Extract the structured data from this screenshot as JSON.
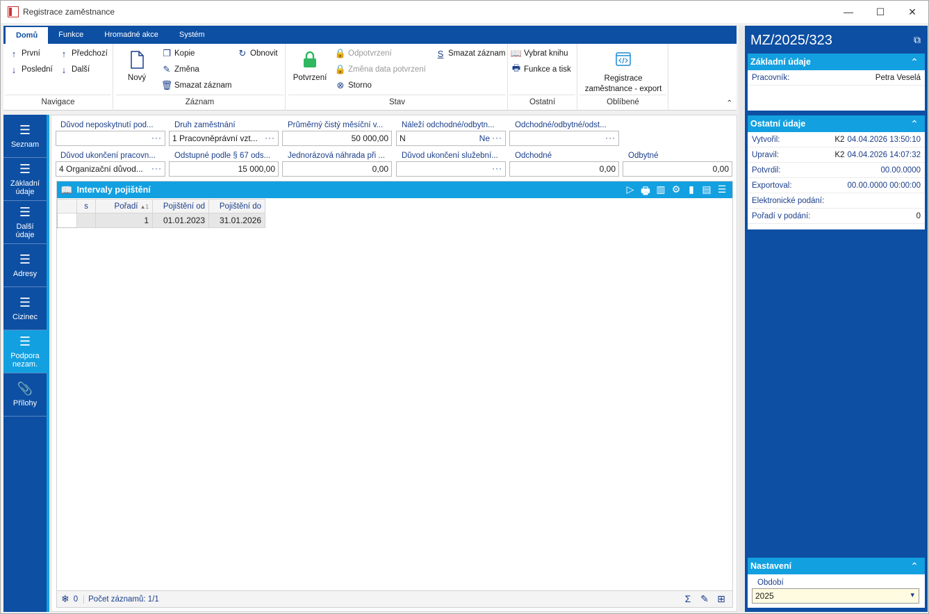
{
  "window": {
    "title": "Registrace zaměstnance"
  },
  "ribbon": {
    "tabs": [
      "Domů",
      "Funkce",
      "Hromadné akce",
      "Systém"
    ],
    "navigace": {
      "prvni": "První",
      "predchozi": "Předchozí",
      "posledni": "Poslední",
      "dalsi": "Další",
      "caption": "Navigace"
    },
    "zaznam": {
      "novy": "Nový",
      "kopie": "Kopie",
      "zmena": "Změna",
      "smazat": "Smazat záznam",
      "obnovit": "Obnovit",
      "caption": "Záznam"
    },
    "stav": {
      "potvrzeni": "Potvrzení",
      "odpotvrzeni": "Odpotvrzení",
      "zmena_data": "Změna data potvrzení",
      "storno": "Storno",
      "smazat": "Smazat záznam",
      "caption": "Stav"
    },
    "ostatni": {
      "vybrat": "Vybrat knihu",
      "funkce": "Funkce a tisk",
      "caption": "Ostatní"
    },
    "oblibene": {
      "registrace": "Registrace",
      "registrace2": "zaměstnance - export",
      "caption": "Oblíbené"
    }
  },
  "nav": {
    "items": [
      "Seznam",
      "Základní",
      "údaje",
      "Další",
      "údaje",
      "Adresy",
      "Cizinec",
      "Podpora",
      "nezam.",
      "Přílohy"
    ]
  },
  "form": {
    "l1": "Důvod neposkytnutí pod...",
    "v1": "",
    "l2": "Druh zaměstnání",
    "v2": "1 Pracovněprávní vzt...",
    "l3": "Průměrný čistý měsíční v...",
    "v3": "50 000,00",
    "l4": "Náleží odchodné/odbytn...",
    "v4a": "N",
    "v4b": "Ne",
    "l5": "Odchodné/odbytné/odst...",
    "v5": "",
    "l6": "Důvod ukončení pracovn...",
    "v6": "4 Organizační důvod...",
    "l7": "Odstupné podle § 67 ods...",
    "v7": "15 000,00",
    "l8": "Jednorázová náhrada při ...",
    "v8": "0,00",
    "l9": "Důvod ukončení služební...",
    "v9": "",
    "l10": "Odchodné",
    "v10": "0,00",
    "l11": "Odbytné",
    "v11": "0,00"
  },
  "grid": {
    "title": "Intervaly pojištění",
    "columns": [
      "s",
      "Pořadí",
      "Pojištění od",
      "Pojištění do"
    ],
    "sort_mark": "▲1",
    "rows": [
      {
        "poradi": "1",
        "od": "01.01.2023",
        "do": "31.01.2026"
      }
    ],
    "footer_count": "0",
    "footer_records": "Počet záznamů: 1/1"
  },
  "right": {
    "title": "MZ/2025/323",
    "zakladni": {
      "header": "Základní údaje",
      "pracovnik_label": "Pracovník:",
      "pracovnik": "Petra Veselá"
    },
    "ostatni": {
      "header": "Ostatní údaje",
      "vytvoril_label": "Vytvořil:",
      "vytvoril_user": "K2",
      "vytvoril": "04.04.2026 13:50:10",
      "upravil_label": "Upravil:",
      "upravil_user": "K2",
      "upravil": "04.04.2026 14:07:32",
      "potvrdil_label": "Potvrdil:",
      "potvrdil": "00.00.0000",
      "exportoval_label": "Exportoval:",
      "exportoval": "00.00.0000 00:00:00",
      "elektronicke_label": "Elektronické podání:",
      "poradi_label": "Pořadí v podání:",
      "poradi": "0"
    },
    "nastaveni": {
      "header": "Nastavení",
      "obdobi_label": "Období",
      "obdobi": "2025"
    }
  }
}
